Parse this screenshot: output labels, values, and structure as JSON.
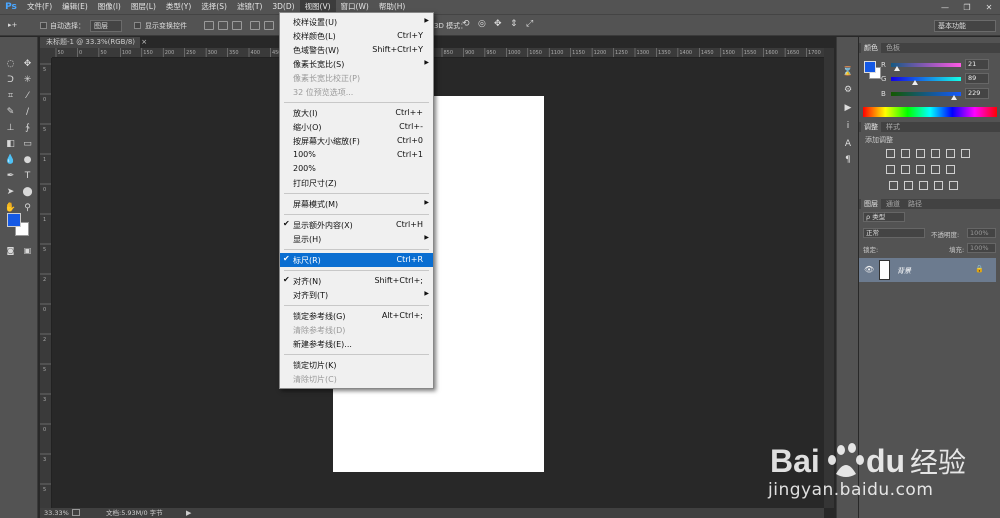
{
  "menubar": {
    "logo": "Ps",
    "items": [
      "文件(F)",
      "编辑(E)",
      "图像(I)",
      "图层(L)",
      "类型(Y)",
      "选择(S)",
      "滤镜(T)",
      "3D(D)",
      "视图(V)",
      "窗口(W)",
      "帮助(H)"
    ],
    "active_index": 8
  },
  "options": {
    "auto_select_label": "自动选择：",
    "auto_select_value": "图层",
    "transform_label": "显示变换控件",
    "mode_3d_label": "3D 模式：",
    "workspace": "基本功能"
  },
  "document": {
    "tab_title": "未标题-1 @ 33.3%(RGB/8)",
    "tab_close": "×",
    "zoom": "33.33%",
    "doc_info": "文档:5.93M/0 字节",
    "ruler_top_labels": [
      "50",
      "0",
      "50",
      "100",
      "150",
      "200",
      "250",
      "300",
      "350",
      "400",
      "450",
      "500",
      "550",
      "600",
      "650",
      "700",
      "750",
      "800",
      "850",
      "900",
      "950",
      "1000",
      "1050",
      "1100",
      "1150",
      "1200",
      "1250",
      "1300",
      "1350",
      "1400",
      "1450",
      "1500",
      "1550",
      "1600",
      "1650",
      "1700"
    ],
    "ruler_left_labels": [
      "5",
      "0",
      "5",
      "1",
      "0",
      "1",
      "5",
      "2",
      "0",
      "2",
      "5",
      "3",
      "0",
      "3",
      "5"
    ]
  },
  "view_menu": {
    "items": [
      {
        "label": "校样设置(U)",
        "shortcut": "",
        "submenu": true,
        "check": false,
        "disabled": false
      },
      {
        "label": "校样颜色(L)",
        "shortcut": "Ctrl+Y",
        "submenu": false,
        "check": false,
        "disabled": false
      },
      {
        "label": "色域警告(W)",
        "shortcut": "Shift+Ctrl+Y",
        "submenu": false,
        "check": false,
        "disabled": false
      },
      {
        "label": "像素长宽比(S)",
        "shortcut": "",
        "submenu": true,
        "check": false,
        "disabled": false
      },
      {
        "label": "像素长宽比校正(P)",
        "shortcut": "",
        "submenu": false,
        "check": false,
        "disabled": true
      },
      {
        "label": "32 位预览选项...",
        "shortcut": "",
        "submenu": false,
        "check": false,
        "disabled": true
      },
      {
        "separator": true
      },
      {
        "label": "放大(I)",
        "shortcut": "Ctrl++",
        "submenu": false,
        "check": false,
        "disabled": false
      },
      {
        "label": "缩小(O)",
        "shortcut": "Ctrl+-",
        "submenu": false,
        "check": false,
        "disabled": false
      },
      {
        "label": "按屏幕大小缩放(F)",
        "shortcut": "Ctrl+0",
        "submenu": false,
        "check": false,
        "disabled": false
      },
      {
        "label": "100%",
        "shortcut": "Ctrl+1",
        "submenu": false,
        "check": false,
        "disabled": false
      },
      {
        "label": "200%",
        "shortcut": "",
        "submenu": false,
        "check": false,
        "disabled": false
      },
      {
        "label": "打印尺寸(Z)",
        "shortcut": "",
        "submenu": false,
        "check": false,
        "disabled": false
      },
      {
        "separator": true
      },
      {
        "label": "屏幕模式(M)",
        "shortcut": "",
        "submenu": true,
        "check": false,
        "disabled": false
      },
      {
        "separator": true
      },
      {
        "label": "显示额外内容(X)",
        "shortcut": "Ctrl+H",
        "submenu": false,
        "check": true,
        "disabled": false
      },
      {
        "label": "显示(H)",
        "shortcut": "",
        "submenu": true,
        "check": false,
        "disabled": false
      },
      {
        "separator": true
      },
      {
        "label": "标尺(R)",
        "shortcut": "Ctrl+R",
        "submenu": false,
        "check": true,
        "disabled": false,
        "selected": true
      },
      {
        "separator": true
      },
      {
        "label": "对齐(N)",
        "shortcut": "Shift+Ctrl+;",
        "submenu": false,
        "check": true,
        "disabled": false
      },
      {
        "label": "对齐到(T)",
        "shortcut": "",
        "submenu": true,
        "check": false,
        "disabled": false
      },
      {
        "separator": true
      },
      {
        "label": "锁定参考线(G)",
        "shortcut": "Alt+Ctrl+;",
        "submenu": false,
        "check": false,
        "disabled": false
      },
      {
        "label": "清除参考线(D)",
        "shortcut": "",
        "submenu": false,
        "check": false,
        "disabled": true
      },
      {
        "label": "新建参考线(E)...",
        "shortcut": "",
        "submenu": false,
        "check": false,
        "disabled": false
      },
      {
        "separator": true
      },
      {
        "label": "锁定切片(K)",
        "shortcut": "",
        "submenu": false,
        "check": false,
        "disabled": false
      },
      {
        "label": "清除切片(C)",
        "shortcut": "",
        "submenu": false,
        "check": false,
        "disabled": true
      }
    ]
  },
  "color_panel": {
    "tabs": [
      "颜色",
      "色板"
    ],
    "channels": [
      {
        "label": "R",
        "value": "21",
        "fraction": 0.082,
        "gradient": [
          "#155983",
          "#ff59e5"
        ]
      },
      {
        "label": "G",
        "value": "89",
        "fraction": 0.349,
        "gradient": [
          "#1500e5",
          "#15ffe5"
        ]
      },
      {
        "label": "B",
        "value": "229",
        "fraction": 0.898,
        "gradient": [
          "#155900",
          "#1559ff"
        ]
      }
    ],
    "foreground": "#1559e5",
    "background": "#ffffff"
  },
  "adjust_panel": {
    "tabs": [
      "调整",
      "样式"
    ],
    "title": "添加调整"
  },
  "layers_panel": {
    "tabs": [
      "图层",
      "通道",
      "路径"
    ],
    "filter_kind": "ρ 类型",
    "blend_mode": "正常",
    "opacity_label": "不透明度:",
    "opacity_value": "100%",
    "lock_label": "锁定:",
    "fill_label": "填充:",
    "fill_value": "100%",
    "layer_name": "背景"
  },
  "watermark": {
    "logo_text": "Bai",
    "logo_text2": "du",
    "logo_cn": "经验",
    "url": "jingyan.baidu.com"
  },
  "colors": {
    "menu_highlight": "#0a6ed1",
    "layer_selected": "#6c7b8f"
  }
}
